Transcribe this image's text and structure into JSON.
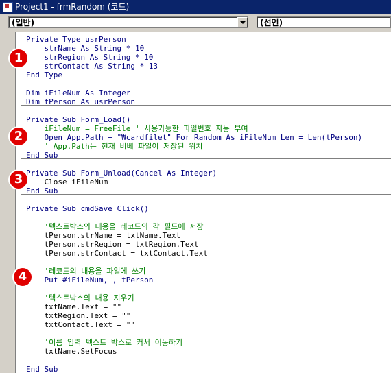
{
  "window": {
    "title": "Project1 - frmRandom (코드)"
  },
  "toolbar": {
    "object_combo": "(일반)",
    "procedure_combo": "(선언)"
  },
  "badges": [
    "1",
    "2",
    "3",
    "4"
  ],
  "code": {
    "l01": "Private Type usrPerson",
    "l02": "    strName As String * 10",
    "l03": "    strRegion As String * 10",
    "l04": "    strContact As String * 13",
    "l05": "End Type",
    "l06": "",
    "l07": "Dim iFileNum As Integer",
    "l08": "Dim tPerson As usrPerson",
    "l09": "",
    "l10": "Private Sub Form_Load()",
    "l11": "    iFileNum = FreeFile ' 사용가능한 파일번호 자동 부여",
    "l12": "    Open App.Path + \"₩cardfilet\" For Random As iFileNum Len = Len(tPerson)",
    "l13": "    ' App.Path는 현재 비베 파일이 저장된 위치",
    "l14": "End Sub",
    "l15": "",
    "l16": "Private Sub Form_Unload(Cancel As Integer)",
    "l17": "    Close iFileNum",
    "l18": "End Sub",
    "l19": "",
    "l20": "Private Sub cmdSave_Click()",
    "l21": "",
    "l22": "    '텍스트박스의 내용을 레코드의 각 필드에 저장",
    "l23": "    tPerson.strName = txtName.Text",
    "l24": "    tPerson.strRegion = txtRegion.Text",
    "l25": "    tPerson.strContact = txtContact.Text",
    "l26": "",
    "l27": "    '레코드의 내용을 파일에 쓰기",
    "l28": "    Put #iFileNum, , tPerson",
    "l29": "",
    "l30": "    '텍스트박스의 내용 지우기",
    "l31": "    txtName.Text = \"\"",
    "l32": "    txtRegion.Text = \"\"",
    "l33": "    txtContact.Text = \"\"",
    "l34": "",
    "l35": "    '이름 입력 텍스트 박스로 커서 이동하기",
    "l36": "    txtName.SetFocus",
    "l37": "",
    "l38": "End Sub"
  }
}
